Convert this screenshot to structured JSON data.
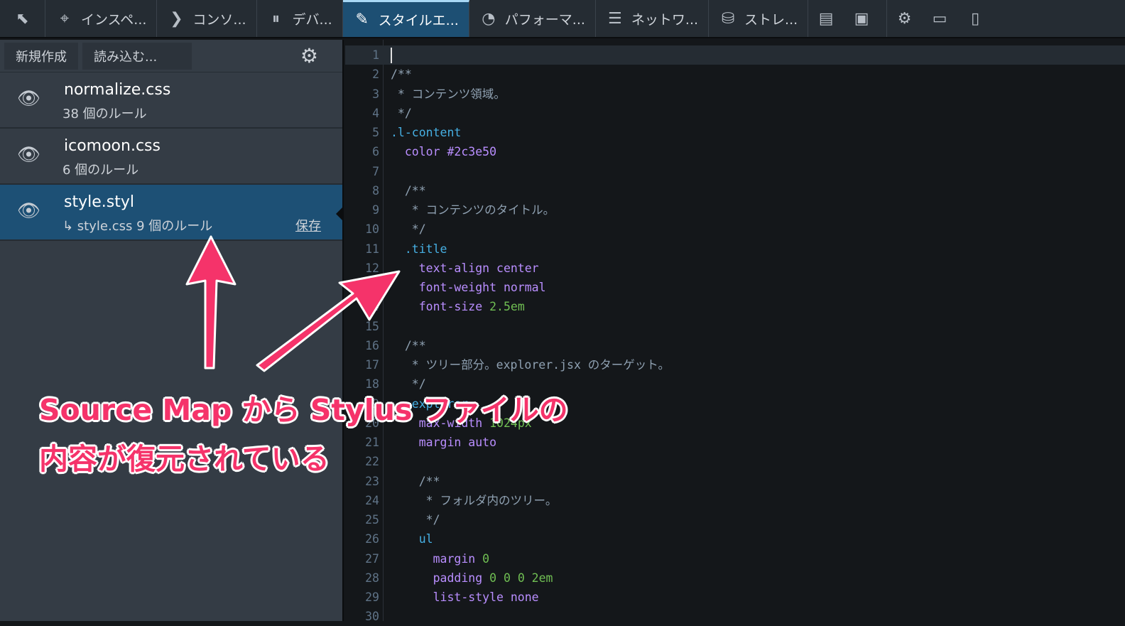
{
  "toolbar": {
    "tabs": [
      {
        "label": "インスペ...",
        "icon": "inspector-icon"
      },
      {
        "label": "コンソ...",
        "icon": "console-icon"
      },
      {
        "label": "デバ...",
        "icon": "debugger-icon"
      },
      {
        "label": "スタイルエ...",
        "icon": "style-editor-icon",
        "selected": true
      },
      {
        "label": "パフォーマ...",
        "icon": "performance-icon"
      },
      {
        "label": "ネットワ...",
        "icon": "network-icon"
      },
      {
        "label": "ストレ...",
        "icon": "storage-icon"
      }
    ]
  },
  "sidebar": {
    "new_label": "新規作成",
    "import_label": "読み込む...",
    "sheets": [
      {
        "name": "normalize.css",
        "rules": "38 個のルール"
      },
      {
        "name": "icomoon.css",
        "rules": "6 個のルール"
      },
      {
        "name": "style.styl",
        "rules": "↳ style.css 9 個のルール",
        "save": "保存",
        "selected": true
      }
    ]
  },
  "editor": {
    "lines": [
      [],
      [
        [
          "c",
          "/**"
        ]
      ],
      [
        [
          "c",
          " * コンテンツ領域。"
        ]
      ],
      [
        [
          "c",
          " */"
        ]
      ],
      [
        [
          "s",
          ".l-content"
        ]
      ],
      [
        [
          "p",
          "  color "
        ],
        [
          "t",
          "#2c3e50"
        ]
      ],
      [],
      [
        [
          "c",
          "  /**"
        ]
      ],
      [
        [
          "c",
          "   * コンテンツのタイトル。"
        ]
      ],
      [
        [
          "c",
          "   */"
        ]
      ],
      [
        [
          "s",
          "  .title"
        ]
      ],
      [
        [
          "p",
          "    text-align center"
        ]
      ],
      [
        [
          "p",
          "    font-weight normal"
        ]
      ],
      [
        [
          "p",
          "    font-size "
        ],
        [
          "n",
          "2.5em"
        ]
      ],
      [],
      [
        [
          "c",
          "  /**"
        ]
      ],
      [
        [
          "c",
          "   * ツリー部分。explorer.jsx のターゲット。"
        ]
      ],
      [
        [
          "c",
          "   */"
        ]
      ],
      [
        [
          "s",
          "  .explorer"
        ]
      ],
      [
        [
          "p",
          "    max-width "
        ],
        [
          "n",
          "1024px"
        ]
      ],
      [
        [
          "p",
          "    margin auto"
        ]
      ],
      [],
      [
        [
          "c",
          "    /**"
        ]
      ],
      [
        [
          "c",
          "     * フォルダ内のツリー。"
        ]
      ],
      [
        [
          "c",
          "     */"
        ]
      ],
      [
        [
          "s",
          "    ul"
        ]
      ],
      [
        [
          "p",
          "      margin "
        ],
        [
          "n",
          "0"
        ]
      ],
      [
        [
          "p",
          "      padding "
        ],
        [
          "n",
          "0 0 0 2em"
        ]
      ],
      [
        [
          "p",
          "      list-style none"
        ]
      ],
      []
    ]
  },
  "annotation": {
    "line1": "Source Map から Stylus ファイルの",
    "line2": "内容が復元されている"
  },
  "colors": {
    "accent": "#f5336a",
    "selected": "#1d5075"
  }
}
